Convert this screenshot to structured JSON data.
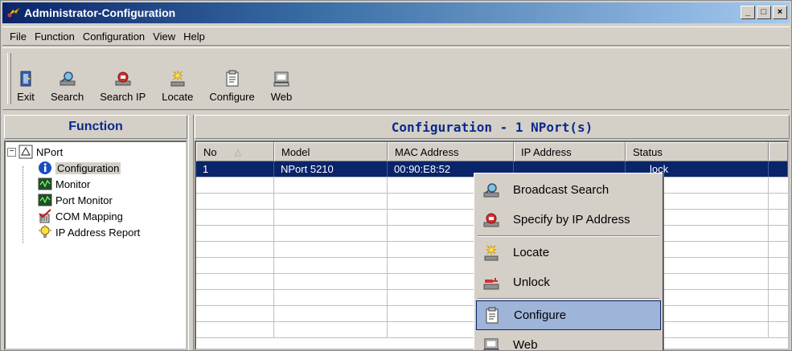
{
  "window": {
    "title": "Administrator-Configuration",
    "min_label": "_",
    "max_label": "□",
    "close_label": "×"
  },
  "menu": [
    {
      "label": "File"
    },
    {
      "label": "Function"
    },
    {
      "label": "Configuration"
    },
    {
      "label": "View"
    },
    {
      "label": "Help"
    }
  ],
  "toolbar": [
    {
      "label": "Exit",
      "icon": "exit-icon"
    },
    {
      "label": "Search",
      "icon": "search-icon"
    },
    {
      "label": "Search IP",
      "icon": "search-ip-icon"
    },
    {
      "label": "Locate",
      "icon": "locate-icon"
    },
    {
      "label": "Configure",
      "icon": "configure-icon"
    },
    {
      "label": "Web",
      "icon": "web-icon"
    }
  ],
  "left": {
    "header": "Function",
    "root": "NPort",
    "items": [
      {
        "label": "Configuration",
        "icon": "info-icon"
      },
      {
        "label": "Monitor",
        "icon": "monitor-icon"
      },
      {
        "label": "Port Monitor",
        "icon": "port-monitor-icon"
      },
      {
        "label": "COM Mapping",
        "icon": "com-mapping-icon"
      },
      {
        "label": "IP Address Report",
        "icon": "lightbulb-icon"
      }
    ]
  },
  "right": {
    "header": "Configuration - 1 NPort(s)",
    "columns": [
      "No",
      "Model",
      "MAC Address",
      "IP Address",
      "Status"
    ],
    "rows": [
      {
        "no": "1",
        "model": "NPort 5210",
        "mac": "00:90:E8:52",
        "ip": "",
        "status": "lock"
      }
    ]
  },
  "context_menu": [
    {
      "label": "Broadcast Search",
      "icon": "broadcast-search-icon"
    },
    {
      "label": "Specify by IP Address",
      "icon": "specify-ip-icon"
    },
    {
      "label": "Locate",
      "icon": "locate-icon"
    },
    {
      "label": "Unlock",
      "icon": "unlock-icon"
    },
    {
      "label": "Configure",
      "icon": "configure-icon",
      "highlighted": true
    },
    {
      "label": "Web",
      "icon": "web-icon"
    }
  ],
  "colors": {
    "title_start": "#0a246a",
    "title_end": "#a6caf0",
    "header_text": "#0a2a8a",
    "selection": "#0a246a"
  }
}
